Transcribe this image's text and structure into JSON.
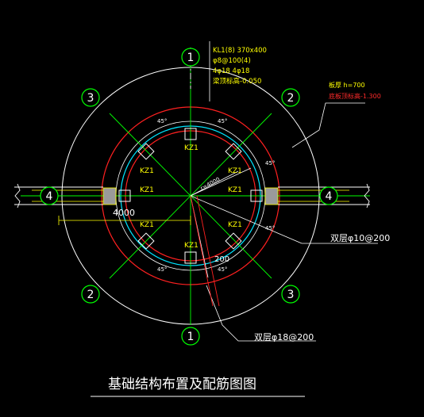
{
  "drawing": {
    "title": "基础结构布置及配筋图图",
    "beam_callout": {
      "line1": "KL1(8) 370x400",
      "line2": "φ8@100(4)",
      "line3": "4φ18 4φ18",
      "line4": "梁顶标高-0.050"
    },
    "foundation_callout": {
      "line1": "板厚  h=700",
      "line2": "底板顶标高-1.300"
    },
    "axis_labels": {
      "top": "1",
      "bottom": "1",
      "upper_left": "3",
      "upper_right": "2",
      "lower_left": "2",
      "lower_right": "3",
      "left": "4",
      "right": "4"
    },
    "columns": [
      "KZ1",
      "KZ1",
      "KZ1",
      "KZ1",
      "KZ1",
      "KZ1",
      "KZ1",
      "KZ1"
    ],
    "rebar_right": "双层φ10@200",
    "rebar_bottom": "双层φ18@200",
    "dim_left": "4000",
    "dim_center": "200",
    "radius_label": "r=4000",
    "angle_labels": [
      "45°",
      "45°",
      "45°",
      "45°",
      "45°",
      "45°"
    ]
  },
  "colors": {
    "background": "#000000",
    "outline": "#ffffff",
    "ring_red": "#ff2020",
    "ring_cyan": "#00e5ff",
    "grid_green": "#00ff00",
    "column_gray": "#9a9a9a",
    "text_yellow": "#ffff00",
    "text_red": "#ff2a2a"
  }
}
